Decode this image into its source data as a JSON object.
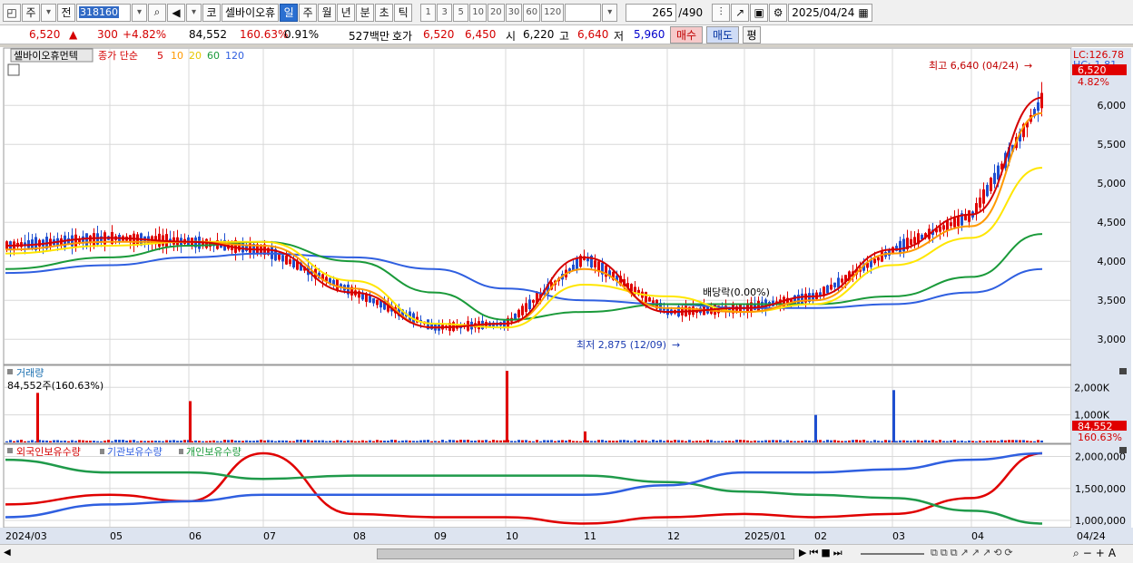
{
  "toolbar": {
    "market_btn": "주",
    "prev_btn": "전",
    "stock_code": "318160",
    "exchange_btn": "코",
    "stock_name": "셀바이오휴",
    "period_tabs": [
      "일",
      "주",
      "월",
      "년",
      "분",
      "초",
      "틱"
    ],
    "active_period": "일",
    "intervals": [
      "1",
      "3",
      "5",
      "10",
      "20",
      "30",
      "60",
      "120"
    ],
    "count": "265",
    "count_total": "/490",
    "date": "2025/04/24"
  },
  "quote": {
    "price": "6,520",
    "change_arrow": "▲",
    "change": "300",
    "change_pct": "+4.82%",
    "volume": "84,552",
    "volume_ratio": "160.63%",
    "turnover_rate": "0.91%",
    "trade_value": "527백만",
    "ask_label": "호가",
    "ask_price": "6,520",
    "bid_price": "6,450",
    "open_label": "시",
    "open": "6,220",
    "high_label": "고",
    "high": "6,640",
    "low_label": "저",
    "low": "5,960",
    "buy_btn": "매수",
    "sell_btn": "매도",
    "eval_btn": "평"
  },
  "price_panel": {
    "name_tag": "셀바이오휴먼텍",
    "ma_label": "종가 단순",
    "ma_periods": [
      "5",
      "10",
      "20",
      "60",
      "120"
    ],
    "lc_label": "LC:126.78",
    "hc_label": "HC:-1.81",
    "current_price_tag": "6,520",
    "current_pct_tag": "4.82%",
    "high_annotation": "최고 6,640 (04/24)",
    "low_annotation": "최저 2,875 (12/09)",
    "dividend_annotation": "배당락(0.00%)",
    "y_ticks": [
      "6,000",
      "5,500",
      "5,000",
      "4,500",
      "4,000",
      "3,500",
      "3,000"
    ]
  },
  "volume_panel": {
    "title": "거래량",
    "info": "84,552주(160.63%)",
    "y_ticks": [
      "2,000K",
      "1,000K"
    ],
    "current_tag": "84,552",
    "current_pct_tag": "160.63%"
  },
  "holdings_panel": {
    "legend": [
      "외국인보유수량",
      "기관보유수량",
      "개인보유수량"
    ],
    "y_ticks": [
      "2,000,000",
      "1,500,000",
      "1,000,000"
    ]
  },
  "x_axis": [
    "2024/03",
    "05",
    "06",
    "07",
    "08",
    "09",
    "10",
    "11",
    "12",
    "2025/01",
    "02",
    "03",
    "04",
    "04/24"
  ],
  "colors": {
    "ma5": "#d40000",
    "ma10": "#ff9900",
    "ma20": "#ffe600",
    "ma60": "#1a9a3a",
    "ma120": "#2f5fe0",
    "up": "#e00000",
    "down": "#1f4fd0",
    "foreign": "#e00000",
    "institution": "#1f9a4a",
    "individual": "#2f5fe0"
  },
  "chart_data": [
    {
      "type": "line",
      "title": "셀바이오휴먼텍",
      "x": [
        "2024/03",
        "05",
        "06",
        "07",
        "08",
        "09",
        "10",
        "11",
        "12",
        "2025/01",
        "02",
        "03",
        "04",
        "04/24"
      ],
      "series": [
        {
          "name": "5",
          "values": [
            4200,
            4300,
            4250,
            4150,
            3600,
            3150,
            3200,
            4050,
            3350,
            3400,
            3550,
            4150,
            4600,
            6100
          ]
        },
        {
          "name": "10",
          "values": [
            4150,
            4250,
            4250,
            4200,
            3650,
            3150,
            3200,
            3900,
            3400,
            3350,
            3500,
            4100,
            4450,
            5900
          ]
        },
        {
          "name": "20",
          "values": [
            4100,
            4200,
            4250,
            4250,
            3750,
            3200,
            3150,
            3700,
            3550,
            3350,
            3450,
            3950,
            4300,
            5200
          ]
        },
        {
          "name": "60",
          "values": [
            3900,
            4050,
            4200,
            4250,
            4000,
            3600,
            3250,
            3350,
            3450,
            3450,
            3450,
            3550,
            3800,
            4350
          ]
        },
        {
          "name": "120",
          "values": [
            3850,
            3950,
            4050,
            4100,
            4050,
            3900,
            3650,
            3500,
            3450,
            3400,
            3400,
            3450,
            3600,
            3900
          ]
        }
      ],
      "ylim": [
        2700,
        6700
      ],
      "y_ticks": [
        3000,
        3500,
        4000,
        4500,
        5000,
        5500,
        6000
      ],
      "annotations": [
        "최고 6,640 (04/24)",
        "최저 2,875 (12/09)",
        "배당락(0.00%)"
      ]
    },
    {
      "type": "bar",
      "title": "거래량",
      "x": [
        "2024/03",
        "05",
        "06",
        "07",
        "08",
        "09",
        "10",
        "11",
        "12",
        "2025/01",
        "02",
        "03",
        "04",
        "04/24"
      ],
      "series": [
        {
          "name": "거래량",
          "values": [
            1800000,
            90000,
            1500000,
            70000,
            60000,
            50000,
            2600000,
            400000,
            150000,
            100000,
            1000000,
            1900000,
            200000,
            84552
          ]
        }
      ],
      "y_ticks": [
        1000000,
        2000000
      ],
      "ylim": [
        0,
        2700000
      ]
    },
    {
      "type": "line",
      "x": [
        "2024/03",
        "05",
        "06",
        "07",
        "08",
        "09",
        "10",
        "11",
        "12",
        "2025/01",
        "02",
        "03",
        "04",
        "04/24"
      ],
      "series": [
        {
          "name": "외국인보유수량",
          "values": [
            1250000,
            1400000,
            1300000,
            2050000,
            1100000,
            1050000,
            1050000,
            950000,
            1050000,
            1100000,
            1050000,
            1100000,
            1350000,
            2050000
          ]
        },
        {
          "name": "기관보유수량",
          "values": [
            1950000,
            1750000,
            1750000,
            1650000,
            1700000,
            1700000,
            1700000,
            1700000,
            1600000,
            1450000,
            1400000,
            1350000,
            1150000,
            950000
          ]
        },
        {
          "name": "개인보유수량",
          "values": [
            1050000,
            1250000,
            1300000,
            1400000,
            1400000,
            1400000,
            1400000,
            1400000,
            1550000,
            1750000,
            1750000,
            1800000,
            1950000,
            2050000
          ]
        }
      ],
      "ylim": [
        900000,
        2150000
      ],
      "y_ticks": [
        1000000,
        1500000,
        2000000
      ]
    }
  ]
}
